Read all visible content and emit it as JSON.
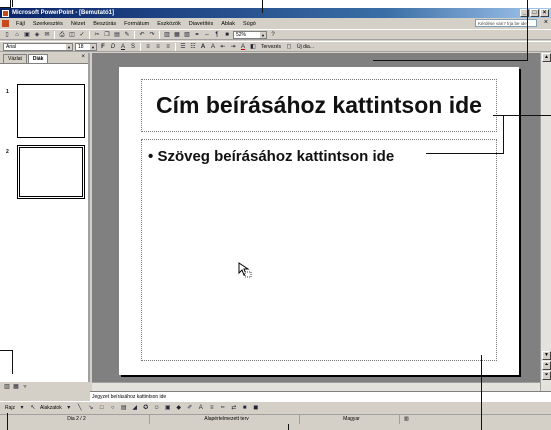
{
  "window": {
    "title": "Microsoft PowerPoint - [Bemutató1]",
    "controls": [
      "_",
      "□",
      "×"
    ]
  },
  "menu": {
    "items": [
      "Fájl",
      "Szerkesztés",
      "Nézet",
      "Beszúrás",
      "Formátum",
      "Eszközök",
      "Diavetítés",
      "Ablak",
      "Súgó"
    ],
    "help_placeholder": "Kérdése van? Írja be ide.",
    "close": "×"
  },
  "standard_toolbar": {
    "zoom": "52%",
    "icons": [
      "new-icon",
      "open-icon",
      "save-icon",
      "permission-icon",
      "email-icon",
      "print-icon",
      "print-preview-icon",
      "spelling-icon",
      "cut-icon",
      "copy-icon",
      "paste-icon",
      "format-painter-icon",
      "undo-icon",
      "redo-icon",
      "chart-icon",
      "table-icon",
      "tables-borders-icon",
      "insert-hyperlink-icon",
      "expand-icon",
      "show-formatting-icon",
      "grayscale-icon",
      "help-icon"
    ]
  },
  "formatting_toolbar": {
    "font": "Arial",
    "size": "18",
    "design_label": "Tervezés",
    "new_slide_label": "Új dia..."
  },
  "left_pane": {
    "tabs": [
      "Vázlat",
      "Diák"
    ],
    "close": "×",
    "slide_numbers": [
      "1",
      "2"
    ]
  },
  "slide": {
    "title_placeholder": "Cím beírásához kattintson ide",
    "body_placeholder": "Szöveg beírásához kattintson ide",
    "bullet": "•"
  },
  "notes": {
    "placeholder": "Jegyzet beírásához kattintson ide"
  },
  "drawing_toolbar": {
    "draw_label": "Rajz",
    "autoshapes_label": "Alakzatok"
  },
  "status_bar": {
    "slide_position": "Dia 2 / 2",
    "design": "Alapértelmezett terv",
    "language": "Magyar"
  }
}
